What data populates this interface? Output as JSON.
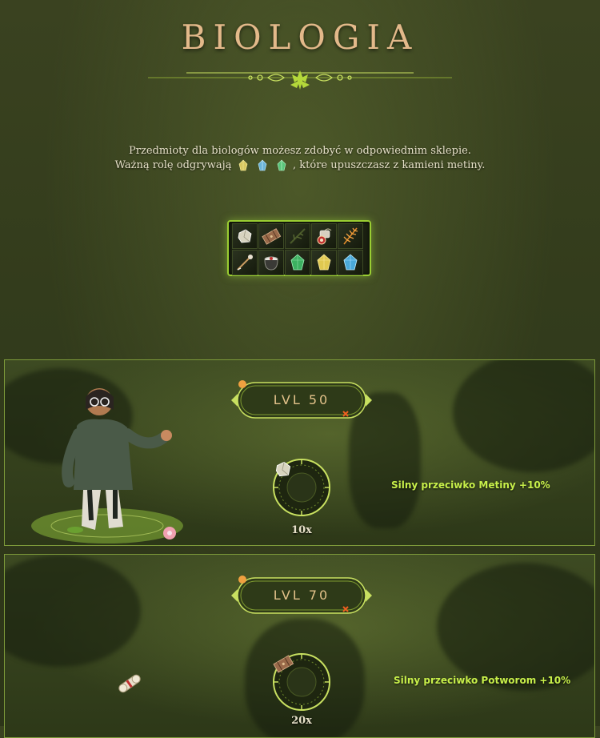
{
  "header": {
    "title": "BIOLOGIA"
  },
  "intro": {
    "line1": "Przedmioty dla biologów możesz zdobyć w odpowiednim sklepie.",
    "line2_before": "Ważną rolę odgrywają",
    "line2_after": ", które upuszczasz z kamieni metiny.",
    "gem_icons": [
      "yellow-stone-icon",
      "blue-stone-icon",
      "green-stone-icon"
    ]
  },
  "item_grid": {
    "items": [
      "white-stone-icon",
      "wooden-crate-icon",
      "branch-icon",
      "lantern-icon",
      "fern-icon",
      "staff-icon",
      "pot-icon",
      "green-stone-icon",
      "yellow-stone-icon",
      "blue-stone-icon"
    ]
  },
  "levels": [
    {
      "label": "LVL 50",
      "reward_icon": "white-stone-icon",
      "reward_count": "10x",
      "bonus": "Silny przeciwko Metiny +10%"
    },
    {
      "label": "LVL 70",
      "reward_icon": "wooden-crate-icon",
      "reward_count": "20x",
      "bonus": "Silny przeciwko Potworom +10%"
    }
  ],
  "colors": {
    "title": "#e3b98a",
    "accent": "#9acd32",
    "bonus": "#c8f04a"
  }
}
